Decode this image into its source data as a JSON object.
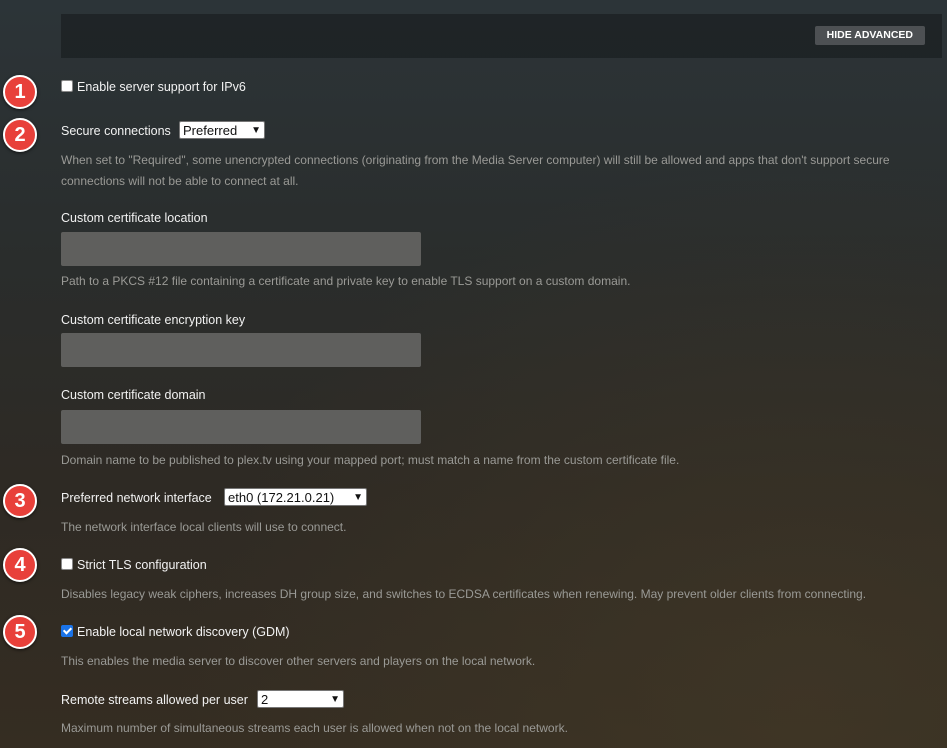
{
  "toolbar": {
    "hide_advanced_label": "HIDE ADVANCED"
  },
  "badges": [
    "1",
    "2",
    "3",
    "4",
    "5"
  ],
  "ipv6": {
    "label": "Enable server support for IPv6",
    "checked": false
  },
  "secure_connections": {
    "label": "Secure connections",
    "value": "Preferred",
    "help": "When set to \"Required\", some unencrypted connections (originating from the Media Server computer) will still be allowed and apps that don't support secure connections will not be able to connect at all."
  },
  "cert_location": {
    "label": "Custom certificate location",
    "value": "",
    "help": "Path to a PKCS #12 file containing a certificate and private key to enable TLS support on a custom domain."
  },
  "cert_key": {
    "label": "Custom certificate encryption key",
    "value": ""
  },
  "cert_domain": {
    "label": "Custom certificate domain",
    "value": "",
    "help": "Domain name to be published to plex.tv using your mapped port; must match a name from the custom certificate file."
  },
  "network_interface": {
    "label": "Preferred network interface",
    "value": "eth0 (172.21.0.21)",
    "help": "The network interface local clients will use to connect."
  },
  "strict_tls": {
    "label": "Strict TLS configuration",
    "checked": false,
    "help": "Disables legacy weak ciphers, increases DH group size, and switches to ECDSA certificates when renewing. May prevent older clients from connecting."
  },
  "gdm": {
    "label": "Enable local network discovery (GDM)",
    "checked": true,
    "help": "This enables the media server to discover other servers and players on the local network."
  },
  "remote_streams": {
    "label": "Remote streams allowed per user",
    "value": "2",
    "help": "Maximum number of simultaneous streams each user is allowed when not on the local network."
  },
  "colors": {
    "badge": "#e8403a",
    "input_bg": "#5f5f5d",
    "help_text": "#9a9a96"
  }
}
